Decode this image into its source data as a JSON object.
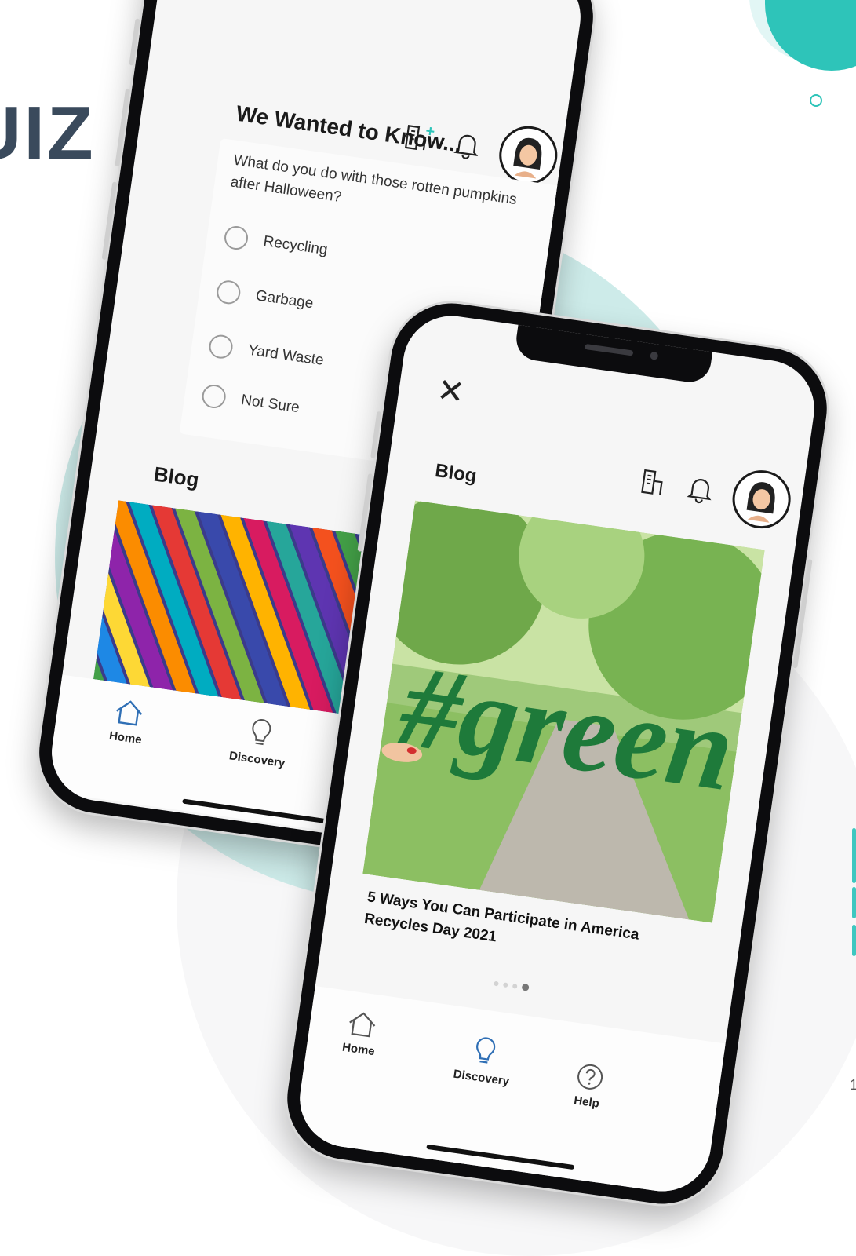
{
  "page": {
    "title": "UIZ",
    "page_number": "1"
  },
  "colors": {
    "teal_accent": "#2ec4b9",
    "teal_light": "#cdebe9",
    "title_navy": "#3a4a5c",
    "active_tab_blue": "#2f6fb5"
  },
  "back_phone": {
    "header": {
      "icons": [
        "building-add-icon",
        "bell-icon",
        "avatar"
      ]
    },
    "quiz": {
      "heading": "We Wanted to Know...",
      "question": "What do you do with those rotten pumpkins after Halloween?",
      "options": [
        {
          "label": "Recycling",
          "selected": false
        },
        {
          "label": "Garbage",
          "selected": false
        },
        {
          "label": "Yard Waste",
          "selected": false
        },
        {
          "label": "Not Sure",
          "selected": false
        }
      ]
    },
    "blog": {
      "heading": "Blog",
      "image": "colorful-straws-image"
    },
    "tabs": [
      {
        "label": "Home",
        "icon": "home-icon"
      },
      {
        "label": "Discovery",
        "icon": "lightbulb-icon"
      }
    ]
  },
  "front_phone": {
    "header": {
      "icons": [
        "close-icon",
        "building-icon",
        "bell-icon",
        "avatar"
      ]
    },
    "blog": {
      "heading": "Blog",
      "image": "green-sign-park-image",
      "image_text": "#green",
      "article_title": "5 Ways You Can Participate in America Recycles Day 2021",
      "carousel_active_index": 3,
      "carousel_count": 4
    },
    "tabs": [
      {
        "label": "Home",
        "icon": "home-icon",
        "active": false
      },
      {
        "label": "Discovery",
        "icon": "lightbulb-icon",
        "active": true
      },
      {
        "label": "Help",
        "icon": "help-icon",
        "active": false
      }
    ]
  }
}
